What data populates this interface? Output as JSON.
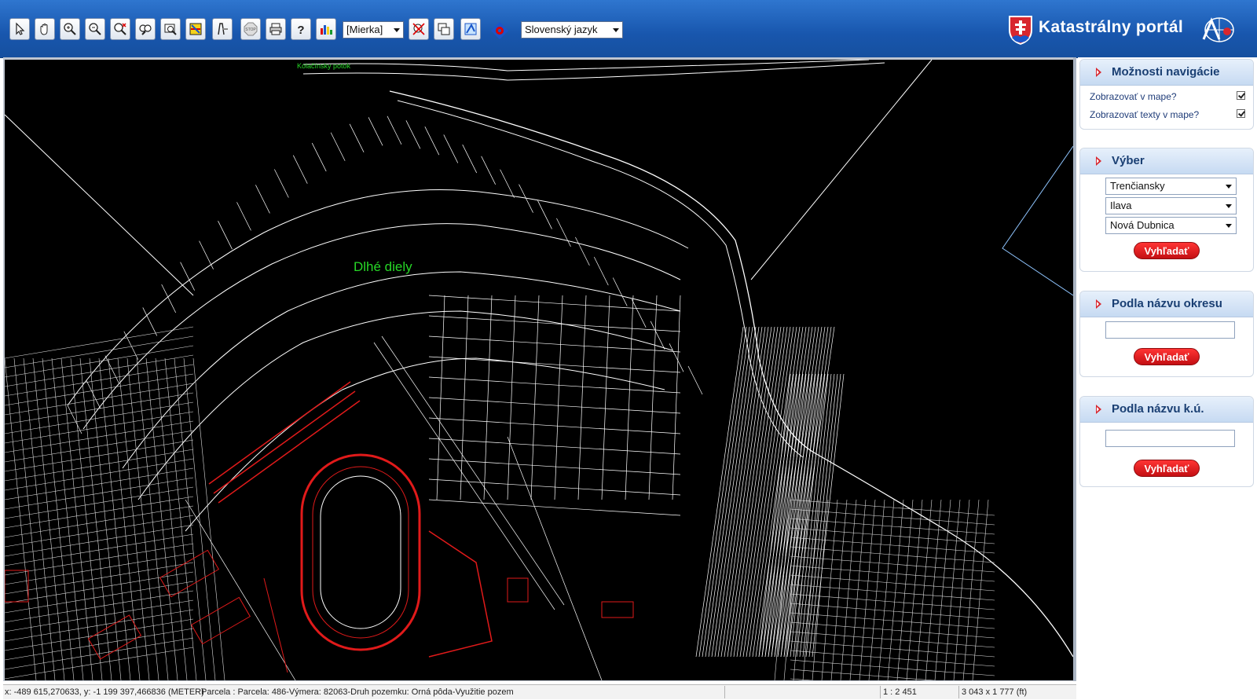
{
  "header": {
    "title": "Katastrálny portál",
    "scale_placeholder": "[Mierka]",
    "language": "Slovenský jazyk"
  },
  "toolbar": {
    "tools": [
      "select-arrow-icon",
      "pan-hand-icon",
      "zoom-in-icon",
      "zoom-out-icon",
      "zoom-clear-icon",
      "zoom-previous-icon",
      "zoom-extent-icon",
      "layers-icon",
      "identify-icon",
      "stop-icon",
      "print-icon",
      "help-icon",
      "legend-chart-icon"
    ],
    "tools2": [
      "clear-selection-icon",
      "windows-icon",
      "export-icon",
      "navigation-compass-icon"
    ]
  },
  "map": {
    "labels": {
      "locality": "Dlhé diely",
      "creek": "Kolačínsky potok"
    }
  },
  "panel": {
    "navigation": {
      "title": "Možnosti navigácie",
      "show_in_map": "Zobrazovať v mape?",
      "show_texts": "Zobrazovať texty v mape?"
    },
    "selection": {
      "title": "Výber",
      "region": "Trenčiansky",
      "district": "Ilava",
      "cadastral": "Nová Dubnica",
      "search_label": "Vyhľadať"
    },
    "by_district": {
      "title": "Podla názvu okresu",
      "search_label": "Vyhľadať"
    },
    "by_cadastral": {
      "title": "Podla názvu k.ú.",
      "search_label": "Vyhľadať"
    }
  },
  "status": {
    "coords": "x: -489 615,270633, y: -1 199 397,466836 (METER)",
    "parcel": "Parcela : Parcela: 486-Výmera: 82063-Druh pozemku: Orná pôda-Využitie pozem",
    "scale": "1 : 2 451",
    "size": "3 043 x 1 777 (ft)"
  },
  "colors": {
    "header_blue": "#1856ad",
    "map_background": "#000000",
    "map_lines": "#ffffff",
    "highlight_red": "#e01a1a",
    "label_green": "#27d827",
    "button_red": "#d8262e"
  }
}
